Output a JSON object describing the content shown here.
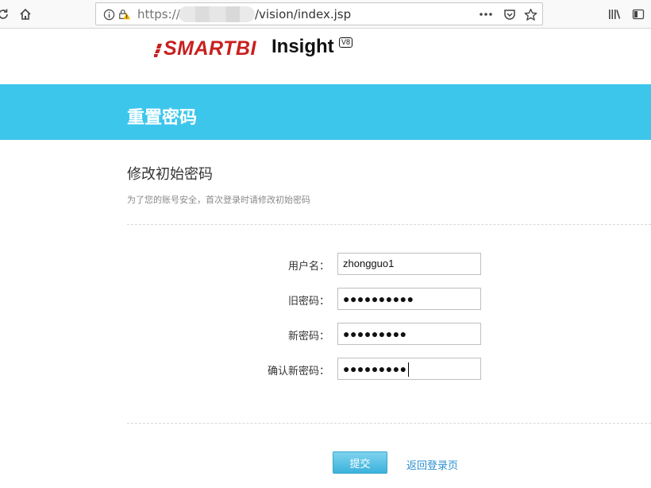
{
  "browser": {
    "url_prefix": "https://",
    "url_path": "/vision/index.jsp",
    "icons": {
      "reload": "reload-icon",
      "home": "home-icon",
      "info": "info-icon",
      "lock_warning": "insecure-lock-icon",
      "more": "more-icon",
      "pocket": "pocket-icon",
      "bookmark": "star-icon",
      "library": "library-icon",
      "sidebar": "sidebar-icon"
    }
  },
  "logo": {
    "brand": "SMARTBI",
    "product": "Insight",
    "version": "V8",
    "brand_color": "#c8201f"
  },
  "header": {
    "title": "重置密码",
    "band_color": "#3dc6ec"
  },
  "section": {
    "title": "修改初始密码",
    "description": "为了您的账号安全，首次登录时请修改初始密码"
  },
  "form": {
    "username": {
      "label": "用户名：",
      "value": "zhongguo1"
    },
    "old_password": {
      "label": "旧密码：",
      "masked": "●●●●●●●●●●"
    },
    "new_password": {
      "label": "新密码：",
      "masked": "●●●●●●●●●"
    },
    "confirm_password": {
      "label": "确认新密码：",
      "masked": "●●●●●●●●●"
    }
  },
  "actions": {
    "submit": "提交",
    "back": "返回登录页"
  }
}
